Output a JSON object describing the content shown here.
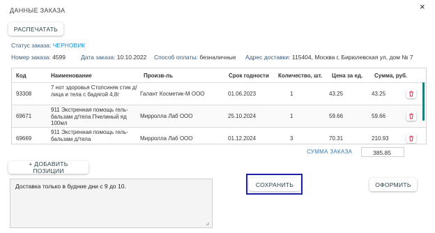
{
  "dialog": {
    "title": "ДАННЫЕ ЗАКАЗА",
    "close_glyph": "×"
  },
  "toolbar": {
    "print_label": "РАСПЕЧАТАТЬ"
  },
  "status": {
    "label": "Статус заказа:",
    "value": "ЧЕРНОВИК"
  },
  "meta": {
    "order_number_label": "Номер заказа:",
    "order_number": "4599",
    "order_date_label": "Дата заказа:",
    "order_date": "10.10.2022",
    "payment_label": "Способ оплаты:",
    "payment": "безналичные",
    "address_label": "Адрес доставки:",
    "address": "115404, Москва г, Бирюлевская ул, дом № 7"
  },
  "table": {
    "headers": [
      "Код",
      "Наименование",
      "Произв-ль",
      "Срок годности",
      "Количество, шт.",
      "Цена за ед.",
      "Сумма, руб."
    ],
    "rows": [
      {
        "code": "93308",
        "name": "7 нот здоровья Стопсиняк стик д/лица и тела с бадягой 4,8г",
        "maker": "Галант Косметик-М ООО",
        "expiry": "01.06.2023",
        "qty": "1",
        "price": "43.25",
        "sum": "43.25"
      },
      {
        "code": "69671",
        "name": "911 Экстренная помощь гель-бальзам д/тела Пчелиный яд 100мл",
        "maker": "Мирролла Лаб ООО",
        "expiry": "25.10.2024",
        "qty": "1",
        "price": "59.66",
        "sum": "59.66"
      },
      {
        "code": "69669",
        "name": "911 Экстренная помощь гель-бальзам д/тела",
        "maker": "Мирролла Лаб ООО",
        "expiry": "01.12.2024",
        "qty": "3",
        "price": "70.31",
        "sum": "210.93"
      }
    ]
  },
  "summary": {
    "label": "СУММА ЗАКАЗА",
    "value": "385.85"
  },
  "actions": {
    "add_label": "+ ДОБАВИТЬ ПОЗИЦИИ",
    "save_label": "СОХРАНИТЬ",
    "submit_label": "ОФОРМИТЬ"
  },
  "comment": {
    "value": "Доставка только в будние дни с 9 до 10."
  },
  "colors": {
    "accent": "#1a8fd0",
    "highlight": "#1e1ea8",
    "scrollbar": "#1f7f7f",
    "trash": "#d9304f"
  },
  "icons": {
    "close": "close-icon",
    "delete": "trash-icon",
    "resize": "resize-grip-icon"
  }
}
